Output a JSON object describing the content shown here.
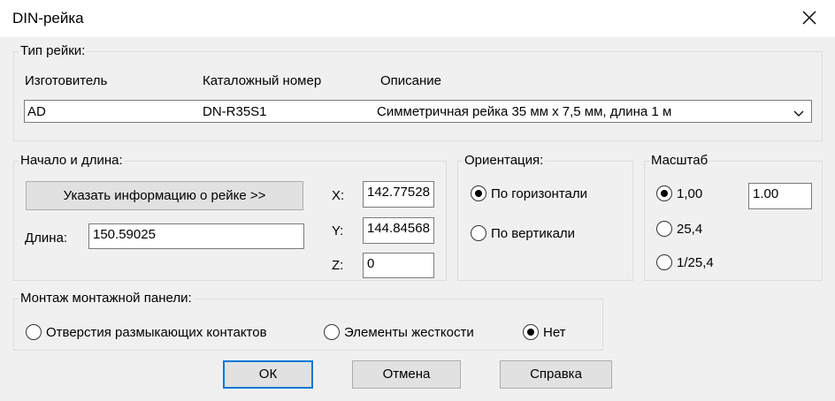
{
  "window": {
    "title": "DIN-рейка"
  },
  "rail_type": {
    "label": "Тип рейки:",
    "columns": [
      "Изготовитель",
      "Каталожный номер",
      "Описание"
    ],
    "selected": {
      "manufacturer": "AD",
      "catalog": "DN-R35S1",
      "description": "Симметричная рейка 35 мм x 7,5 мм, длина 1 м"
    }
  },
  "start_length": {
    "label": "Начало и длина:",
    "specify_button": "Указать информацию о рейке >>",
    "length_label": "Длина:",
    "length_value": "150.59025",
    "x_label": "X:",
    "x_value": "142.77528",
    "y_label": "Y:",
    "y_value": "144.84568",
    "z_label": "Z:",
    "z_value": "0"
  },
  "orientation": {
    "label": "Ориентация:",
    "horizontal": "По горизонтали",
    "vertical": "По вертикали",
    "selected": "horizontal"
  },
  "scale": {
    "label": "Масштаб",
    "options": [
      "1,00",
      "25,4",
      "1/25,4"
    ],
    "selected_index": 0,
    "value": "1.00"
  },
  "mounting": {
    "label": "Монтаж монтажной панели:",
    "options": [
      "Отверстия размыкающих контактов",
      "Элементы жесткости",
      "Нет"
    ],
    "selected_index": 2
  },
  "buttons": {
    "ok": "ОК",
    "cancel": "Отмена",
    "help": "Справка"
  },
  "colors": {
    "accent": "#0078d7",
    "background": "#f0f0f0"
  }
}
